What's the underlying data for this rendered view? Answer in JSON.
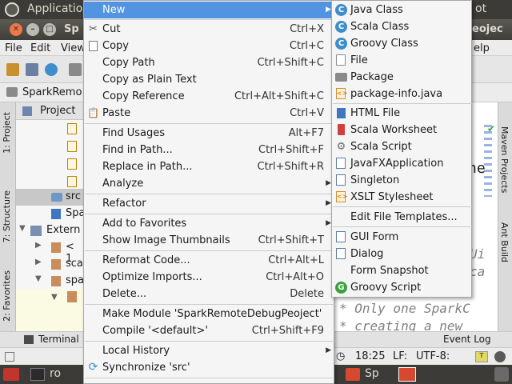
{
  "topbar": {
    "app_title": "Application",
    "tail": "ot"
  },
  "window": {
    "title_left": "Sp",
    "title_right": "eojec"
  },
  "menubar": {
    "items": [
      "File",
      "Edit",
      "View",
      "elp"
    ]
  },
  "navbar": {
    "breadcrumb": "SparkRemo"
  },
  "left_tabs": {
    "project": "1: Project",
    "structure": "7: Structure",
    "favorites": "2: Favorites"
  },
  "project_panel": {
    "header": "Project",
    "rows": [
      "src",
      "Spa",
      "Extern",
      "< 1",
      "sca",
      "spa"
    ]
  },
  "right_tabs": {
    "maven": "Maven Projects",
    "ant": "Ant Build"
  },
  "editor": {
    "fragment_1": "he",
    "fragment_2": "Ui",
    "fragment_3": "ca",
    "comment_1": "* Only one SparkC",
    "comment_2": "* creating a new"
  },
  "bottom_bar": {
    "terminal": "Terminal",
    "event_log": "Event Log"
  },
  "status_bar": {
    "time": "18:25",
    "line_sep": "LF:",
    "encoding": "UTF-8:"
  },
  "taskbar": {
    "item_1": "ro",
    "item_2": "Sp"
  },
  "context_menu": {
    "items": [
      {
        "label": "New",
        "shortcut": "",
        "submenu": true,
        "highlighted": true
      },
      {
        "label": "Cut",
        "shortcut": "Ctrl+X",
        "icon": "scissors-icon"
      },
      {
        "label": "Copy",
        "shortcut": "Ctrl+C",
        "icon": "copy-icon"
      },
      {
        "label": "Copy Path",
        "shortcut": "Ctrl+Shift+C"
      },
      {
        "label": "Copy as Plain Text",
        "shortcut": ""
      },
      {
        "label": "Copy Reference",
        "shortcut": "Ctrl+Alt+Shift+C"
      },
      {
        "label": "Paste",
        "shortcut": "Ctrl+V",
        "icon": "clipboard-icon"
      },
      {
        "label": "Find Usages",
        "shortcut": "Alt+F7"
      },
      {
        "label": "Find in Path...",
        "shortcut": "Ctrl+Shift+F"
      },
      {
        "label": "Replace in Path...",
        "shortcut": "Ctrl+Shift+R"
      },
      {
        "label": "Analyze",
        "shortcut": "",
        "submenu": true
      },
      {
        "label": "Refactor",
        "shortcut": "",
        "submenu": true
      },
      {
        "label": "Add to Favorites",
        "shortcut": "",
        "submenu": true
      },
      {
        "label": "Show Image Thumbnails",
        "shortcut": "Ctrl+Shift+T"
      },
      {
        "label": "Reformat Code...",
        "shortcut": "Ctrl+Alt+L"
      },
      {
        "label": "Optimize Imports...",
        "shortcut": "Ctrl+Alt+O"
      },
      {
        "label": "Delete...",
        "shortcut": "Delete"
      },
      {
        "label": "Make Module 'SparkRemoteDebugPeoject'",
        "shortcut": ""
      },
      {
        "label": "Compile '<default>'",
        "shortcut": "Ctrl+Shift+F9"
      },
      {
        "label": "Local History",
        "shortcut": "",
        "submenu": true
      },
      {
        "label": "Synchronize 'src'",
        "shortcut": "",
        "icon": "sync-icon"
      }
    ]
  },
  "new_submenu": {
    "items": [
      {
        "label": "Java Class",
        "icon": "java-class-icon"
      },
      {
        "label": "Scala Class",
        "icon": "scala-class-icon"
      },
      {
        "label": "Groovy Class",
        "icon": "groovy-class-icon"
      },
      {
        "label": "File",
        "icon": "file-icon"
      },
      {
        "label": "Package",
        "icon": "package-icon"
      },
      {
        "label": "package-info.java",
        "icon": "java-file-icon"
      },
      {
        "label": "HTML File",
        "icon": "html-file-icon"
      },
      {
        "label": "Scala Worksheet",
        "icon": "scala-worksheet-icon"
      },
      {
        "label": "Scala Script",
        "icon": "scala-script-icon"
      },
      {
        "label": "JavaFXApplication",
        "icon": "javafx-icon"
      },
      {
        "label": "Singleton",
        "icon": "singleton-icon"
      },
      {
        "label": "XSLT Stylesheet",
        "icon": "xslt-icon"
      },
      {
        "label": "Edit File Templates...",
        "icon": ""
      },
      {
        "label": "GUI Form",
        "icon": "gui-form-icon"
      },
      {
        "label": "Dialog",
        "icon": "dialog-icon"
      },
      {
        "label": "Form Snapshot",
        "icon": ""
      },
      {
        "label": "Groovy Script",
        "icon": "groovy-script-icon"
      }
    ]
  },
  "colors": {
    "highlight": "#5294e2",
    "menu_bg": "#f5f5f5",
    "panel_dark": "#3c3b37"
  }
}
